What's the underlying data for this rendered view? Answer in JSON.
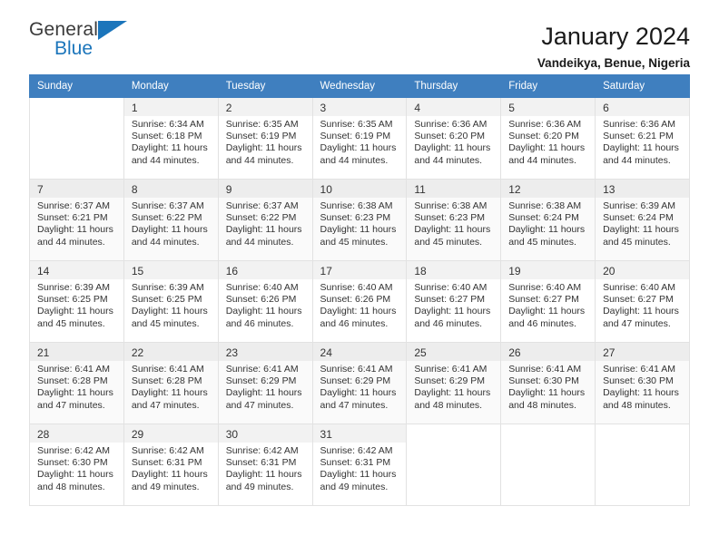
{
  "brand": {
    "word_one": "General",
    "word_two": "Blue",
    "triangle_color": "#1b75bb"
  },
  "header": {
    "title": "January 2024",
    "location": "Vandeikya, Benue, Nigeria"
  },
  "calendar": {
    "header_bg": "#3f7fbf",
    "weekdays": [
      "Sunday",
      "Monday",
      "Tuesday",
      "Wednesday",
      "Thursday",
      "Friday",
      "Saturday"
    ],
    "weeks": [
      [
        {
          "day": "",
          "info": ""
        },
        {
          "day": "1",
          "info": "Sunrise: 6:34 AM\nSunset: 6:18 PM\nDaylight: 11 hours\nand 44 minutes."
        },
        {
          "day": "2",
          "info": "Sunrise: 6:35 AM\nSunset: 6:19 PM\nDaylight: 11 hours\nand 44 minutes."
        },
        {
          "day": "3",
          "info": "Sunrise: 6:35 AM\nSunset: 6:19 PM\nDaylight: 11 hours\nand 44 minutes."
        },
        {
          "day": "4",
          "info": "Sunrise: 6:36 AM\nSunset: 6:20 PM\nDaylight: 11 hours\nand 44 minutes."
        },
        {
          "day": "5",
          "info": "Sunrise: 6:36 AM\nSunset: 6:20 PM\nDaylight: 11 hours\nand 44 minutes."
        },
        {
          "day": "6",
          "info": "Sunrise: 6:36 AM\nSunset: 6:21 PM\nDaylight: 11 hours\nand 44 minutes."
        }
      ],
      [
        {
          "day": "7",
          "info": "Sunrise: 6:37 AM\nSunset: 6:21 PM\nDaylight: 11 hours\nand 44 minutes."
        },
        {
          "day": "8",
          "info": "Sunrise: 6:37 AM\nSunset: 6:22 PM\nDaylight: 11 hours\nand 44 minutes."
        },
        {
          "day": "9",
          "info": "Sunrise: 6:37 AM\nSunset: 6:22 PM\nDaylight: 11 hours\nand 44 minutes."
        },
        {
          "day": "10",
          "info": "Sunrise: 6:38 AM\nSunset: 6:23 PM\nDaylight: 11 hours\nand 45 minutes."
        },
        {
          "day": "11",
          "info": "Sunrise: 6:38 AM\nSunset: 6:23 PM\nDaylight: 11 hours\nand 45 minutes."
        },
        {
          "day": "12",
          "info": "Sunrise: 6:38 AM\nSunset: 6:24 PM\nDaylight: 11 hours\nand 45 minutes."
        },
        {
          "day": "13",
          "info": "Sunrise: 6:39 AM\nSunset: 6:24 PM\nDaylight: 11 hours\nand 45 minutes."
        }
      ],
      [
        {
          "day": "14",
          "info": "Sunrise: 6:39 AM\nSunset: 6:25 PM\nDaylight: 11 hours\nand 45 minutes."
        },
        {
          "day": "15",
          "info": "Sunrise: 6:39 AM\nSunset: 6:25 PM\nDaylight: 11 hours\nand 45 minutes."
        },
        {
          "day": "16",
          "info": "Sunrise: 6:40 AM\nSunset: 6:26 PM\nDaylight: 11 hours\nand 46 minutes."
        },
        {
          "day": "17",
          "info": "Sunrise: 6:40 AM\nSunset: 6:26 PM\nDaylight: 11 hours\nand 46 minutes."
        },
        {
          "day": "18",
          "info": "Sunrise: 6:40 AM\nSunset: 6:27 PM\nDaylight: 11 hours\nand 46 minutes."
        },
        {
          "day": "19",
          "info": "Sunrise: 6:40 AM\nSunset: 6:27 PM\nDaylight: 11 hours\nand 46 minutes."
        },
        {
          "day": "20",
          "info": "Sunrise: 6:40 AM\nSunset: 6:27 PM\nDaylight: 11 hours\nand 47 minutes."
        }
      ],
      [
        {
          "day": "21",
          "info": "Sunrise: 6:41 AM\nSunset: 6:28 PM\nDaylight: 11 hours\nand 47 minutes."
        },
        {
          "day": "22",
          "info": "Sunrise: 6:41 AM\nSunset: 6:28 PM\nDaylight: 11 hours\nand 47 minutes."
        },
        {
          "day": "23",
          "info": "Sunrise: 6:41 AM\nSunset: 6:29 PM\nDaylight: 11 hours\nand 47 minutes."
        },
        {
          "day": "24",
          "info": "Sunrise: 6:41 AM\nSunset: 6:29 PM\nDaylight: 11 hours\nand 47 minutes."
        },
        {
          "day": "25",
          "info": "Sunrise: 6:41 AM\nSunset: 6:29 PM\nDaylight: 11 hours\nand 48 minutes."
        },
        {
          "day": "26",
          "info": "Sunrise: 6:41 AM\nSunset: 6:30 PM\nDaylight: 11 hours\nand 48 minutes."
        },
        {
          "day": "27",
          "info": "Sunrise: 6:41 AM\nSunset: 6:30 PM\nDaylight: 11 hours\nand 48 minutes."
        }
      ],
      [
        {
          "day": "28",
          "info": "Sunrise: 6:42 AM\nSunset: 6:30 PM\nDaylight: 11 hours\nand 48 minutes."
        },
        {
          "day": "29",
          "info": "Sunrise: 6:42 AM\nSunset: 6:31 PM\nDaylight: 11 hours\nand 49 minutes."
        },
        {
          "day": "30",
          "info": "Sunrise: 6:42 AM\nSunset: 6:31 PM\nDaylight: 11 hours\nand 49 minutes."
        },
        {
          "day": "31",
          "info": "Sunrise: 6:42 AM\nSunset: 6:31 PM\nDaylight: 11 hours\nand 49 minutes."
        },
        {
          "day": "",
          "info": ""
        },
        {
          "day": "",
          "info": ""
        },
        {
          "day": "",
          "info": ""
        }
      ]
    ]
  }
}
